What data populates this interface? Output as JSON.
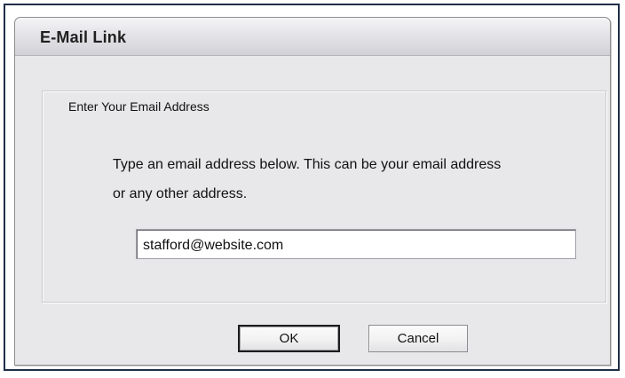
{
  "dialog": {
    "title": "E-Mail Link",
    "group_label": "Enter Your Email Address",
    "instruction_line1": "Type an email address below. This can be your email address",
    "instruction_line2": "or any other address.",
    "email_value": "stafford@website.com",
    "ok_label": "OK",
    "cancel_label": "Cancel"
  }
}
